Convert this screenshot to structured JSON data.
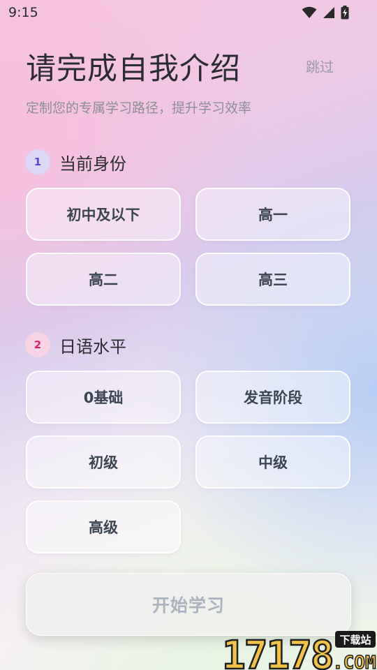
{
  "status_bar": {
    "time": "9:15"
  },
  "header": {
    "title": "请完成自我介绍",
    "skip_label": "跳过",
    "subtitle": "定制您的专属学习路径，提升学习效率"
  },
  "sections": [
    {
      "number": "1",
      "label": "当前身份",
      "options": [
        "初中及以下",
        "高一",
        "高二",
        "高三"
      ]
    },
    {
      "number": "2",
      "label": "日语水平",
      "options": [
        "0基础",
        "发音阶段",
        "初级",
        "中级",
        "高级"
      ]
    }
  ],
  "start_button": {
    "label": "开始学习"
  },
  "watermark": {
    "number": "17178",
    "tag": "下载站",
    "domain": ".COM"
  },
  "colors": {
    "title": "#2b2b33",
    "subtitle": "#8d8d98",
    "option_text": "#3b4450",
    "section1_accent": "#5b46d8",
    "section2_accent": "#d6256f",
    "button_disabled_text": "#aab4bf"
  },
  "icons": {
    "status": [
      "wifi-icon",
      "cellular-signal-icon",
      "battery-charging-icon"
    ]
  }
}
